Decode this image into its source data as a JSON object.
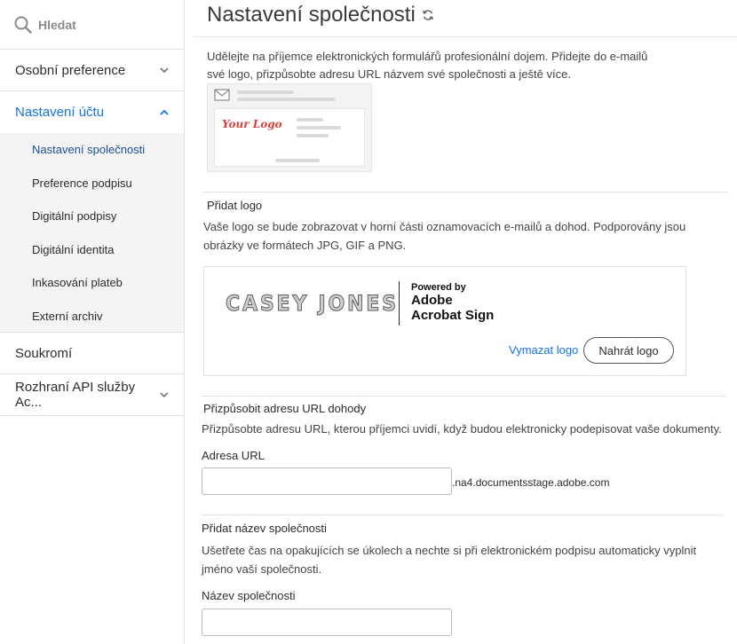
{
  "sidebar": {
    "search_label": "Hledat",
    "items": [
      {
        "label": "Osobní preference"
      },
      {
        "label": "Nastavení účtu"
      },
      {
        "label": "Soukromí"
      },
      {
        "label": "Rozhraní API služby Ac..."
      }
    ],
    "subitems": [
      {
        "label": "Nastavení společnosti"
      },
      {
        "label": "Preference podpisu"
      },
      {
        "label": "Digitální podpisy"
      },
      {
        "label": "Digitální identita"
      },
      {
        "label": "Inkasování plateb"
      },
      {
        "label": "Externí archiv"
      }
    ]
  },
  "main": {
    "title": "Nastavení společnosti",
    "intro": "Udělejte na příjemce elektronických formulářů profesionální dojem. Přidejte do e-mailů své logo, přizpůsobte adresu URL názvem své společnosti a ještě více.",
    "preview_logo_text": "Your Logo",
    "add_logo": {
      "title": "Přidat logo",
      "description": "Vaše logo se bude zobrazovat v horní části oznamovacích e-mailů a dohod. Podporovány jsou obrázky ve formátech JPG, GIF a PNG.",
      "company_logo_text": "CASEY JONES",
      "powered_by": "Powered by",
      "brand_line1": "Adobe",
      "brand_line2": "Acrobat Sign",
      "remove_label": "Vymazat logo",
      "upload_label": "Nahrát logo"
    },
    "url": {
      "title": "Přizpůsobit adresu URL dohody",
      "description": "Přizpůsobte adresu URL, kterou příjemci uvidí, když budou elektronicky podepisovat vaše dokumenty.",
      "field_label": "Adresa URL",
      "value": "",
      "suffix": ".na4.documentsstage.adobe.com"
    },
    "company_name": {
      "title": "Přidat název společnosti",
      "description": "Ušetřete čas na opakujících se úkolech a nechte si při elektronickém podpisu automaticky vyplnit jméno vaší společnosti.",
      "field_label": "Název společnosti",
      "value": ""
    }
  },
  "colors": {
    "accent": "#1473e6",
    "active_subitem": "#1a4f9c",
    "logo_red": "#d9413b"
  }
}
